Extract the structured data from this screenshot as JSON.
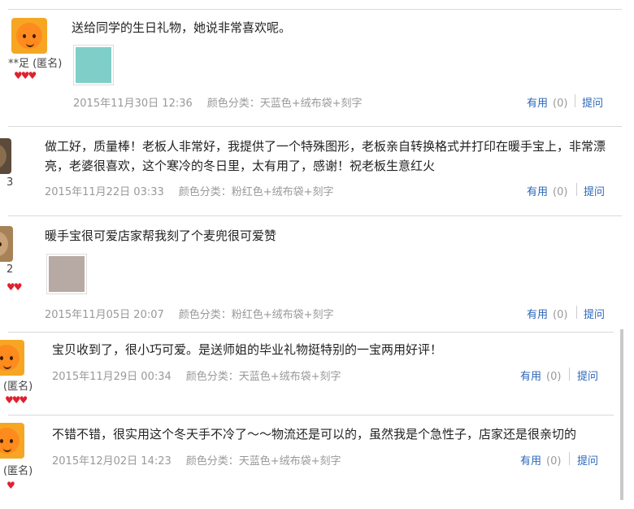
{
  "reviews": [
    {
      "user": "**足 (匿名)",
      "hearts": "♥♥♥",
      "text": "送给同学的生日礼物，她说非常喜欢呢。",
      "date": "2015年11月30日 12:36",
      "category": "颜色分类：天蓝色+绒布袋+刻字",
      "useful": "有用",
      "useful_count": "(0)",
      "ask": "提问",
      "has_photo": true,
      "photo_color": "#7fcfc8"
    },
    {
      "user": "3",
      "hearts": "",
      "text": "做工好，质量棒！老板人非常好，我提供了一个特殊图形，老板亲自转换格式并打印在暖手宝上，非常漂亮，老婆很喜欢，这个寒冷的冬日里，太有用了，感谢！祝老板生意红火",
      "date": "2015年11月22日 03:33",
      "category": "颜色分类：粉红色+绒布袋+刻字",
      "useful": "有用",
      "useful_count": "(0)",
      "ask": "提问",
      "has_photo": false
    },
    {
      "user": "2",
      "hearts": "♥♥",
      "text": "暖手宝很可爱店家帮我刻了个麦兜很可爱赞",
      "date": "2015年11月05日 20:07",
      "category": "颜色分类：粉红色+绒布袋+刻字",
      "useful": "有用",
      "useful_count": "(0)",
      "ask": "提问",
      "has_photo": true,
      "photo_color": "#b7a9a3"
    },
    {
      "user": "(匿名)",
      "hearts": "♥♥♥",
      "text": "宝贝收到了，很小巧可爱。是送师姐的毕业礼物挺特别的一宝两用好评！",
      "date": "2015年11月29日 00:34",
      "category": "颜色分类：天蓝色+绒布袋+刻字",
      "useful": "有用",
      "useful_count": "(0)",
      "ask": "提问",
      "has_photo": false
    },
    {
      "user": "(匿名)",
      "hearts": "♥",
      "text": "不错不错，很实用这个冬天手不冷了～～物流还是可以的，虽然我是个急性子，店家还是很亲切的",
      "date": "2015年12月02日 14:23",
      "category": "颜色分类：天蓝色+绒布袋+刻字",
      "useful": "有用",
      "useful_count": "(0)",
      "ask": "提问",
      "has_photo": false
    }
  ],
  "colors": {
    "link": "#2a66b9",
    "meta": "#999999",
    "heart": "#e0202e"
  }
}
